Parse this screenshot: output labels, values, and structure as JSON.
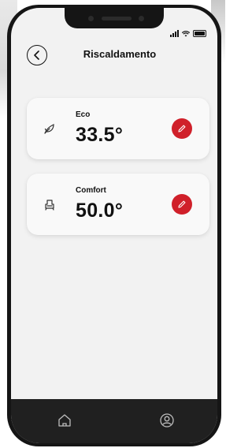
{
  "header": {
    "title": "Riscaldamento"
  },
  "cards": [
    {
      "label": "Eco",
      "value": "33.5°",
      "icon": "leaf-icon"
    },
    {
      "label": "Comfort",
      "value": "50.0°",
      "icon": "armchair-icon"
    }
  ],
  "nav": {
    "items": [
      "home-icon",
      "profile-icon"
    ]
  },
  "colors": {
    "accent": "#d0202a",
    "background": "#f2f2f2",
    "bottom_bar": "#202020"
  }
}
